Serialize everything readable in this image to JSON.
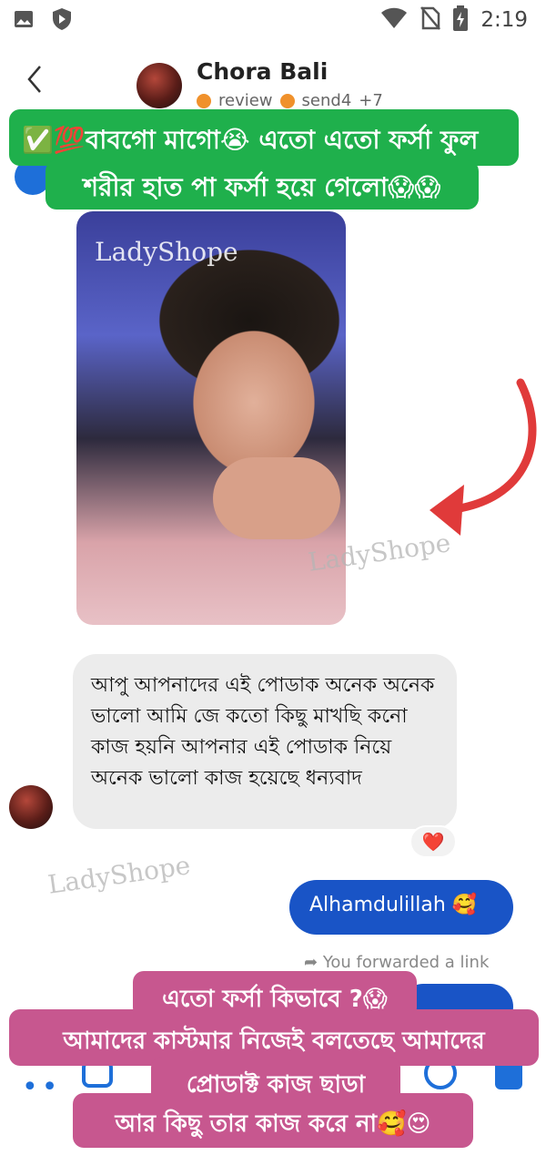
{
  "status_bar": {
    "time": "2:19",
    "icons": [
      "gallery-icon",
      "shield-icon",
      "wifi-icon",
      "no-sim-icon",
      "battery-charging-icon"
    ]
  },
  "header": {
    "back_icon": "chevron-left-icon",
    "name": "Chora Bali",
    "tag1": "review",
    "tag2": "send4",
    "more": "+7",
    "tag_color": "#f0912b"
  },
  "banner_top": {
    "line1": "✅💯বাবগো মাগো😭  এতো এতো ফর্সা ফুল",
    "line2": "শরীর হাত পা ফর্সা হয়ে গেলো😱😱",
    "color": "#1fb04c"
  },
  "photo": {
    "watermark": "LadyShope"
  },
  "watermarks": {
    "a": "LadyShope",
    "b": "LadyShope"
  },
  "messages": {
    "received": {
      "text": "আপু আপনাদের এই পোডাক অনেক অনেক ভালো আমি জে কতো কিছু মাখছি কনো কাজ হয়নি আপনার এই পোডাক নিয়ে অনেক ভালো কাজ হয়েছে ধন্যবাদ",
      "reaction": "❤️"
    },
    "sent": {
      "text": "Alhamdulillah 🥰",
      "color": "#1954c6"
    },
    "forward_note": "You forwarded a link"
  },
  "banner_bottom": {
    "line1": "এতো ফর্সা কিভাবে ?😱",
    "line2": "আমাদের কাস্টমার নিজেই বলতেছে আমাদের",
    "line3": "প্রোডাক্ট কাজ ছাড়া",
    "line4": "আর কিছু তার কাজ করে না🥰😍",
    "color": "#c7578f"
  },
  "arrow_color": "#e03a3a"
}
